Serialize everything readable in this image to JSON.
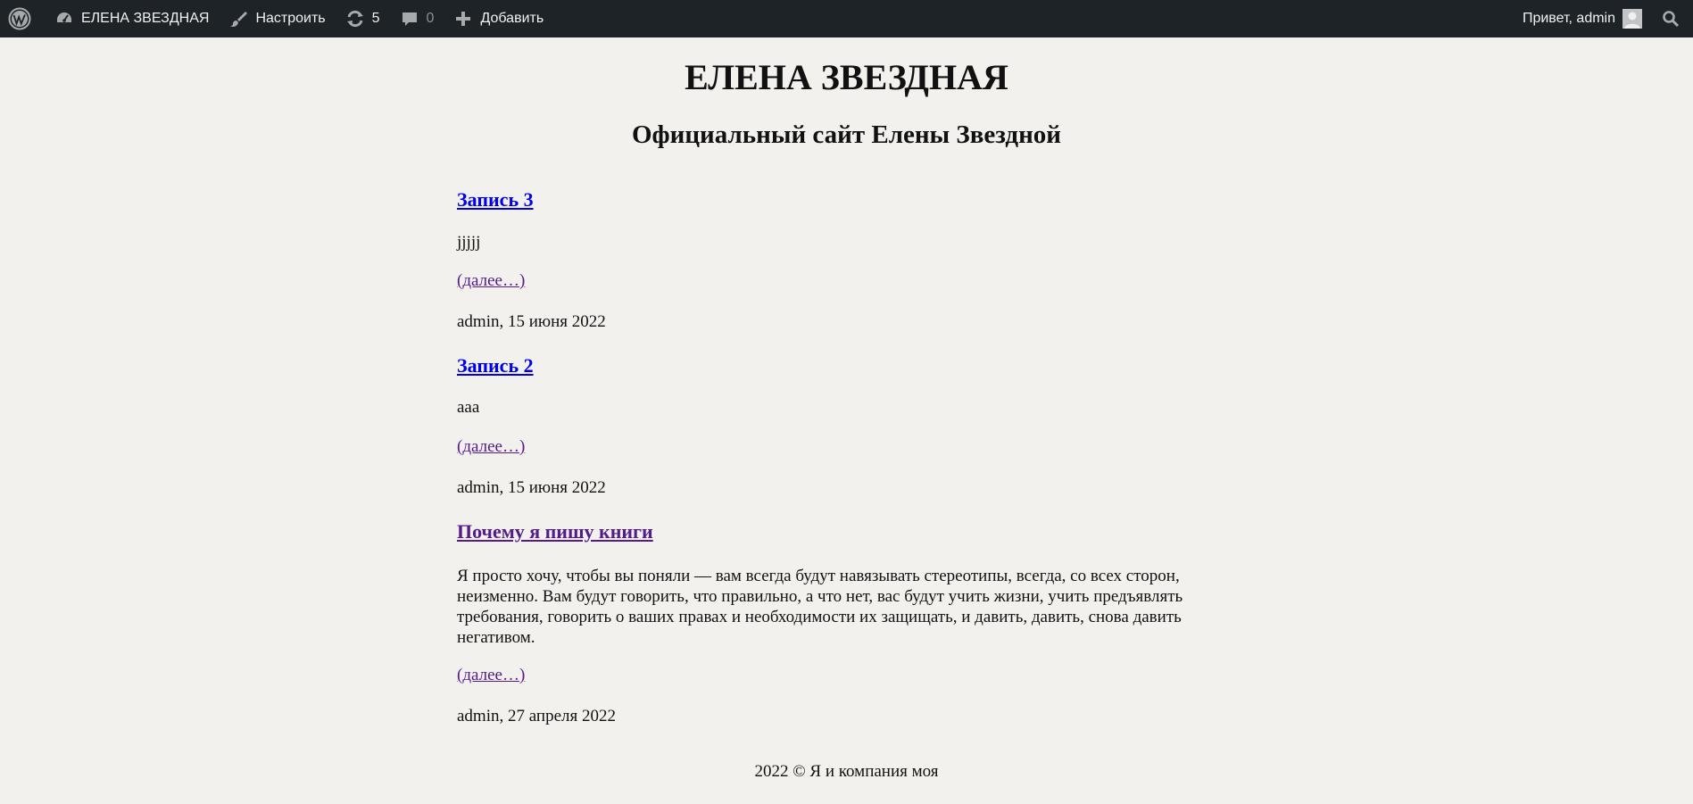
{
  "adminbar": {
    "site_name": "ЕЛЕНА ЗВЕЗДНАЯ",
    "customize_label": "Настроить",
    "updates_count": "5",
    "comments_count": "0",
    "new_label": "Добавить",
    "greeting": "Привет, admin",
    "icons": {
      "wp": "wordpress-logo-icon",
      "dashboard": "dashboard-gauge-icon",
      "customize": "paintbrush-icon",
      "updates": "refresh-icon",
      "comments": "speech-bubble-icon",
      "new": "plus-icon",
      "avatar": "user-avatar-icon",
      "search": "search-icon"
    },
    "colors": {
      "bar": "#1d2327",
      "text": "#f0f0f1",
      "muted": "#8c8f94"
    }
  },
  "site": {
    "title": "ЕЛЕНА ЗВЕЗДНАЯ",
    "description": "Официальный сайт Елены Звездной"
  },
  "posts": [
    {
      "title": "Запись 3",
      "excerpt": "jjjjj",
      "more": "(далее…)",
      "meta": "admin, 15 июня 2022"
    },
    {
      "title": "Запись 2",
      "excerpt": "aaa",
      "more": "(далее…)",
      "meta": "admin, 15 июня 2022"
    },
    {
      "title": "Почему я пишу книги",
      "excerpt_lines": [
        "Я просто хочу, чтобы вы поняли — вам всегда будут навязывать стереотипы, всегда, со всех сторон,",
        "неизменно. Вам будут говорить, что правильно, а что нет, вас будут учить жизни, учить предъявлять",
        "требования, говорить о ваших правах и необходимости их защищать, и давить, давить, снова давить",
        "негативом."
      ],
      "more": "(далее…)",
      "meta": "admin, 27 апреля 2022"
    }
  ],
  "footer": {
    "text": "2022 © Я и компания моя"
  },
  "colors": {
    "background": "#f2f1ed",
    "link": "#0000ee",
    "visited_link": "#551a8b"
  }
}
